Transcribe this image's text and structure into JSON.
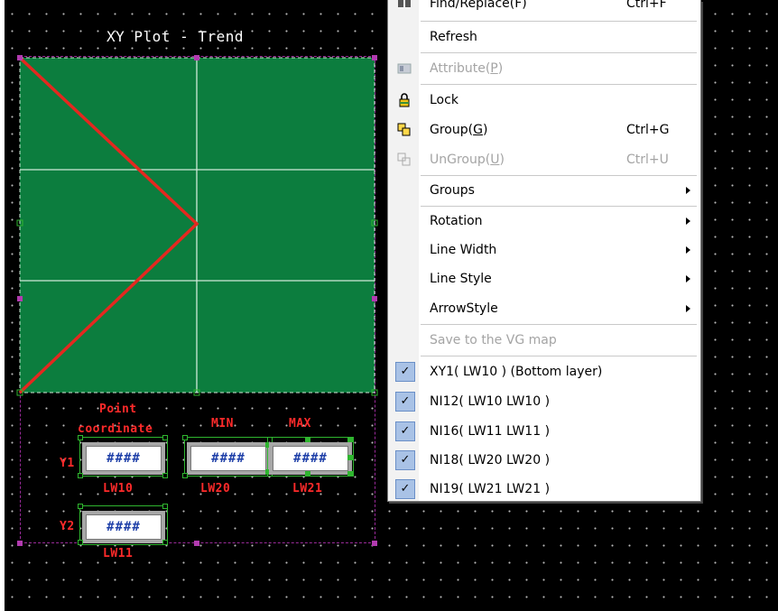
{
  "plot": {
    "title": "XY Plot - Trend",
    "point_coordinate_label_line1": "Point",
    "point_coordinate_label_line2": "coordinate",
    "min_label": "MIN",
    "max_label": "MAX",
    "y1_label": "Y1",
    "y2_label": "Y2",
    "y1_box": {
      "value": "####",
      "address": "LW10"
    },
    "min_box": {
      "value": "####",
      "address": "LW20"
    },
    "max_box": {
      "value": "####",
      "address": "LW21"
    },
    "y2_box": {
      "value": "####",
      "address": "LW11"
    },
    "colors": {
      "plot_bg": "#0c7d3e",
      "trend_line": "#e4281f",
      "grid": "#cfe9d8",
      "label": "#ff2a2a"
    }
  },
  "menu": {
    "top_item": {
      "label": "Find/Replace(F)",
      "shortcut": "Ctrl+F"
    },
    "refresh": "Refresh",
    "attribute": {
      "label": "Attribute(",
      "key": "P",
      "suffix": ")"
    },
    "lock": "Lock",
    "group": {
      "label": "Group(",
      "key": "G",
      "suffix": ")",
      "shortcut": "Ctrl+G"
    },
    "ungroup": {
      "label": "UnGroup(",
      "key": "U",
      "suffix": ")",
      "shortcut": "Ctrl+U"
    },
    "groups": "Groups",
    "rotation": "Rotation",
    "line_width": "Line Width",
    "line_style": "Line Style",
    "arrow_style": "ArrowStyle",
    "save_vg": "Save to the VG map",
    "layers": [
      {
        "label": "XY1( LW10 ) (Bottom layer)",
        "checked": true
      },
      {
        "label": "NI12( LW10 LW10 )",
        "checked": true
      },
      {
        "label": "NI16( LW11 LW11 )",
        "checked": true
      },
      {
        "label": "NI18( LW20 LW20 )",
        "checked": true
      },
      {
        "label": "NI19( LW21 LW21 )",
        "checked": true
      }
    ]
  }
}
